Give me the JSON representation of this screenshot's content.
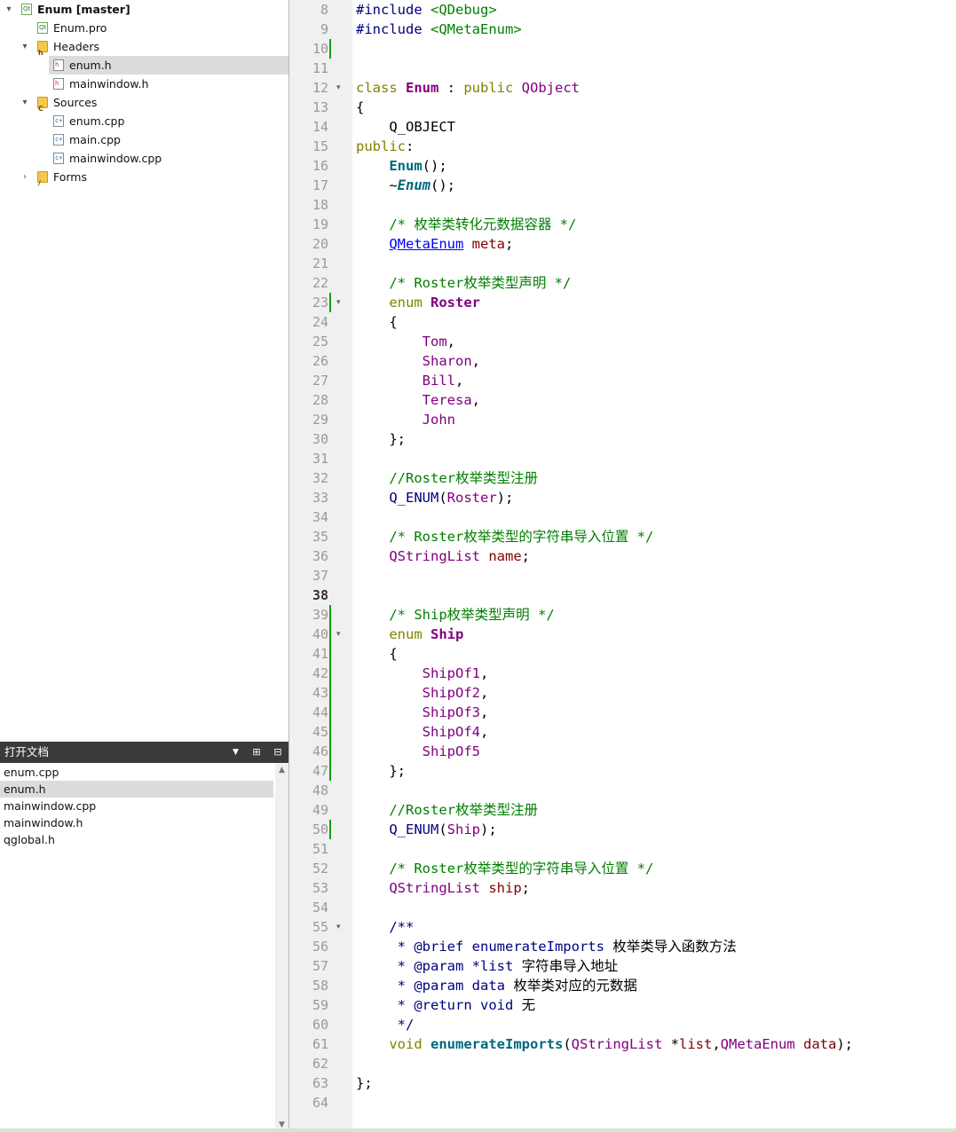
{
  "project_tree": {
    "items": [
      {
        "label": "Enum [master]",
        "indent": 0,
        "arrow": "▾",
        "icon": "project-icon",
        "bold": true
      },
      {
        "label": "Enum.pro",
        "indent": 1,
        "arrow": "",
        "icon": "pro-file-icon"
      },
      {
        "label": "Headers",
        "indent": 1,
        "arrow": "▾",
        "icon": "header-folder-icon"
      },
      {
        "label": "enum.h",
        "indent": 2,
        "arrow": "",
        "icon": "header-file-icon",
        "selected": true
      },
      {
        "label": "mainwindow.h",
        "indent": 2,
        "arrow": "",
        "icon": "header-file-icon"
      },
      {
        "label": "Sources",
        "indent": 1,
        "arrow": "▾",
        "icon": "source-folder-icon"
      },
      {
        "label": "enum.cpp",
        "indent": 2,
        "arrow": "",
        "icon": "cpp-file-icon"
      },
      {
        "label": "main.cpp",
        "indent": 2,
        "arrow": "",
        "icon": "cpp-file-icon"
      },
      {
        "label": "mainwindow.cpp",
        "indent": 2,
        "arrow": "",
        "icon": "cpp-file-icon"
      },
      {
        "label": "Forms",
        "indent": 1,
        "arrow": "›",
        "icon": "forms-folder-icon"
      }
    ]
  },
  "open_documents": {
    "title": "打开文档",
    "items": [
      "enum.cpp",
      "enum.h",
      "mainwindow.cpp",
      "mainwindow.h",
      "qglobal.h"
    ],
    "selected": 1
  },
  "editor": {
    "current_line": 38,
    "lines": [
      {
        "n": "8",
        "tokens": [
          [
            "pp",
            "#include "
          ],
          [
            "str",
            "<QDebug>"
          ]
        ]
      },
      {
        "n": "9",
        "tokens": [
          [
            "pp",
            "#include "
          ],
          [
            "str",
            "<QMetaEnum>"
          ]
        ]
      },
      {
        "n": "10",
        "tokens": []
      },
      {
        "n": "11",
        "tokens": []
      },
      {
        "n": "12",
        "tokens": [
          [
            "kw",
            "class "
          ],
          [
            "ty",
            "Enum"
          ],
          [
            "",
            " : "
          ],
          [
            "kw",
            "public "
          ],
          [
            "cls",
            "QObject"
          ]
        ],
        "fold": true
      },
      {
        "n": "13",
        "tokens": [
          [
            "",
            "{"
          ]
        ]
      },
      {
        "n": "14",
        "tokens": [
          [
            "",
            "    Q_OBJECT"
          ]
        ]
      },
      {
        "n": "15",
        "tokens": [
          [
            "kw",
            "public"
          ],
          [
            "",
            ":"
          ]
        ]
      },
      {
        "n": "16",
        "tokens": [
          [
            "",
            "    "
          ],
          [
            "fn",
            "Enum"
          ],
          [
            "",
            "();"
          ]
        ]
      },
      {
        "n": "17",
        "tokens": [
          [
            "",
            "    ~"
          ],
          [
            "fni",
            "Enum"
          ],
          [
            "",
            "();"
          ]
        ]
      },
      {
        "n": "18",
        "tokens": []
      },
      {
        "n": "19",
        "tokens": [
          [
            "cm",
            "    /* 枚举类转化元数据容器 */"
          ]
        ]
      },
      {
        "n": "20",
        "tokens": [
          [
            "",
            "    "
          ],
          [
            "lnk",
            "QMetaEnum"
          ],
          [
            "",
            " "
          ],
          [
            "mem",
            "meta"
          ],
          [
            "",
            ";"
          ]
        ]
      },
      {
        "n": "21",
        "tokens": []
      },
      {
        "n": "22",
        "tokens": [
          [
            "cm",
            "    /* Roster枚举类型声明 */"
          ]
        ]
      },
      {
        "n": "23",
        "tokens": [
          [
            "",
            "    "
          ],
          [
            "kw",
            "enum "
          ],
          [
            "ty",
            "Roster"
          ]
        ],
        "fold": true
      },
      {
        "n": "24",
        "tokens": [
          [
            "",
            "    {"
          ]
        ]
      },
      {
        "n": "25",
        "tokens": [
          [
            "",
            "        "
          ],
          [
            "en",
            "Tom"
          ],
          [
            "",
            ","
          ]
        ]
      },
      {
        "n": "26",
        "tokens": [
          [
            "",
            "        "
          ],
          [
            "en",
            "Sharon"
          ],
          [
            "",
            ","
          ]
        ]
      },
      {
        "n": "27",
        "tokens": [
          [
            "",
            "        "
          ],
          [
            "en",
            "Bill"
          ],
          [
            "",
            ","
          ]
        ]
      },
      {
        "n": "28",
        "tokens": [
          [
            "",
            "        "
          ],
          [
            "en",
            "Teresa"
          ],
          [
            "",
            ","
          ]
        ]
      },
      {
        "n": "29",
        "tokens": [
          [
            "",
            "        "
          ],
          [
            "en",
            "John"
          ]
        ]
      },
      {
        "n": "30",
        "tokens": [
          [
            "",
            "    };"
          ]
        ]
      },
      {
        "n": "31",
        "tokens": []
      },
      {
        "n": "32",
        "tokens": [
          [
            "cm",
            "    //Roster枚举类型注册"
          ]
        ]
      },
      {
        "n": "33",
        "tokens": [
          [
            "",
            "    "
          ],
          [
            "mac",
            "Q_ENUM"
          ],
          [
            "",
            "("
          ],
          [
            "cls",
            "Roster"
          ],
          [
            "",
            ");"
          ]
        ]
      },
      {
        "n": "34",
        "tokens": []
      },
      {
        "n": "35",
        "tokens": [
          [
            "cm",
            "    /* Roster枚举类型的字符串导入位置 */"
          ]
        ]
      },
      {
        "n": "36",
        "tokens": [
          [
            "",
            "    "
          ],
          [
            "cls",
            "QStringList"
          ],
          [
            "",
            " "
          ],
          [
            "mem",
            "name"
          ],
          [
            "",
            ";"
          ]
        ]
      },
      {
        "n": "37",
        "tokens": []
      },
      {
        "n": "38",
        "tokens": []
      },
      {
        "n": "39",
        "tokens": [
          [
            "cm",
            "    /* Ship枚举类型声明 */"
          ]
        ]
      },
      {
        "n": "40",
        "tokens": [
          [
            "",
            "    "
          ],
          [
            "kw",
            "enum "
          ],
          [
            "ty",
            "Ship"
          ]
        ],
        "fold": true
      },
      {
        "n": "41",
        "tokens": [
          [
            "",
            "    {"
          ]
        ]
      },
      {
        "n": "42",
        "tokens": [
          [
            "",
            "        "
          ],
          [
            "en",
            "ShipOf1"
          ],
          [
            "",
            ","
          ]
        ]
      },
      {
        "n": "43",
        "tokens": [
          [
            "",
            "        "
          ],
          [
            "en",
            "ShipOf2"
          ],
          [
            "",
            ","
          ]
        ]
      },
      {
        "n": "44",
        "tokens": [
          [
            "",
            "        "
          ],
          [
            "en",
            "ShipOf3"
          ],
          [
            "",
            ","
          ]
        ]
      },
      {
        "n": "45",
        "tokens": [
          [
            "",
            "        "
          ],
          [
            "en",
            "ShipOf4"
          ],
          [
            "",
            ","
          ]
        ]
      },
      {
        "n": "46",
        "tokens": [
          [
            "",
            "        "
          ],
          [
            "en",
            "ShipOf5"
          ]
        ]
      },
      {
        "n": "47",
        "tokens": [
          [
            "",
            "    };"
          ]
        ]
      },
      {
        "n": "48",
        "tokens": []
      },
      {
        "n": "49",
        "tokens": [
          [
            "cm",
            "    //Roster枚举类型注册"
          ]
        ]
      },
      {
        "n": "50",
        "tokens": [
          [
            "",
            "    "
          ],
          [
            "mac",
            "Q_ENUM"
          ],
          [
            "",
            "("
          ],
          [
            "cls",
            "Ship"
          ],
          [
            "",
            ");"
          ]
        ]
      },
      {
        "n": "51",
        "tokens": []
      },
      {
        "n": "52",
        "tokens": [
          [
            "cm",
            "    /* Roster枚举类型的字符串导入位置 */"
          ]
        ]
      },
      {
        "n": "53",
        "tokens": [
          [
            "",
            "    "
          ],
          [
            "cls",
            "QStringList"
          ],
          [
            "",
            " "
          ],
          [
            "mem",
            "ship"
          ],
          [
            "",
            ";"
          ]
        ]
      },
      {
        "n": "54",
        "tokens": []
      },
      {
        "n": "55",
        "tokens": [
          [
            "dox",
            "    /**"
          ]
        ],
        "fold": true
      },
      {
        "n": "56",
        "tokens": [
          [
            "dox",
            "     * "
          ],
          [
            "dox",
            "@brief "
          ],
          [
            "dox",
            "enumerateImports "
          ],
          [
            "",
            "枚举类导入函数方法"
          ]
        ]
      },
      {
        "n": "57",
        "tokens": [
          [
            "dox",
            "     * "
          ],
          [
            "dox",
            "@param "
          ],
          [
            "dox",
            "*list "
          ],
          [
            "",
            "字符串导入地址"
          ]
        ]
      },
      {
        "n": "58",
        "tokens": [
          [
            "dox",
            "     * "
          ],
          [
            "dox",
            "@param "
          ],
          [
            "dox",
            "data "
          ],
          [
            "",
            "枚举类对应的元数据"
          ]
        ]
      },
      {
        "n": "59",
        "tokens": [
          [
            "dox",
            "     * "
          ],
          [
            "dox",
            "@return "
          ],
          [
            "dox",
            "void "
          ],
          [
            "",
            "无"
          ]
        ]
      },
      {
        "n": "60",
        "tokens": [
          [
            "dox",
            "     */"
          ]
        ]
      },
      {
        "n": "61",
        "tokens": [
          [
            "",
            "    "
          ],
          [
            "kw",
            "void "
          ],
          [
            "fn",
            "enumerateImports"
          ],
          [
            "",
            "("
          ],
          [
            "cls",
            "QStringList"
          ],
          [
            "",
            " *"
          ],
          [
            "mem",
            "list"
          ],
          [
            "",
            ","
          ],
          [
            "cls",
            "QMetaEnum"
          ],
          [
            "",
            " "
          ],
          [
            "mem",
            "data"
          ],
          [
            "",
            ");"
          ]
        ]
      },
      {
        "n": "62",
        "tokens": []
      },
      {
        "n": "63",
        "tokens": [
          [
            "",
            "};"
          ]
        ]
      },
      {
        "n": "64",
        "tokens": []
      }
    ]
  },
  "colors": {
    "change_marker": "#11a011",
    "keyword": "#808000",
    "comment": "#008000",
    "type": "#800080",
    "function": "#00677c"
  }
}
